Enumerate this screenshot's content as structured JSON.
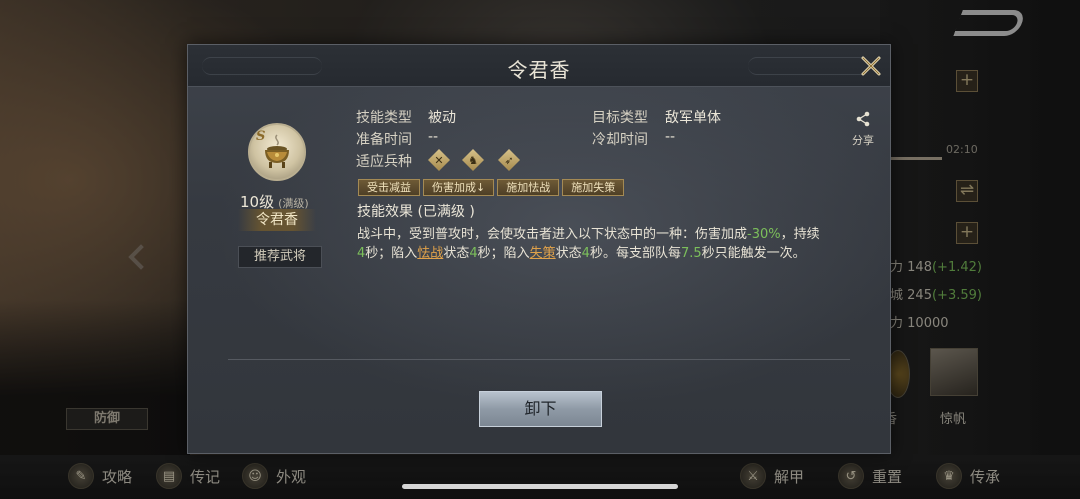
{
  "modal": {
    "title": "令君香",
    "skill": {
      "grade": "S",
      "level": "10级",
      "level_status": "(满级)",
      "name": "令君香",
      "recommend_label": "推荐武将"
    },
    "info": {
      "skill_type_label": "技能类型",
      "skill_type_value": "被动",
      "target_type_label": "目标类型",
      "target_type_value": "敌军单体",
      "prep_time_label": "准备时间",
      "prep_time_value": "--",
      "cooldown_label": "冷却时间",
      "cooldown_value": "--",
      "troops_label": "适应兵种",
      "troop_icons": [
        "spear-troop-icon",
        "cavalry-troop-icon",
        "archer-troop-icon"
      ]
    },
    "share_label": "分享",
    "tags": [
      "受击减益",
      "伤害加成↓",
      "施加怯战",
      "施加失策"
    ],
    "effect_title": "技能效果 (已满级 )",
    "effect": {
      "p1": "战斗中，受到普攻时，会使攻击者进入以下状态中的一种：伤害加成",
      "v1": "-30%",
      "p2": "，持续",
      "v2": "4",
      "p3": "秒；陷入",
      "s1": "怯战",
      "p4": "状态",
      "v3": "4",
      "p5": "秒；陷入",
      "s2": "失策",
      "p6": "状态",
      "v4": "4",
      "p7": "秒。每支部队每",
      "v5": "7.5",
      "p8": "秒只能触发一次。"
    },
    "unload_label": "卸下"
  },
  "background": {
    "timer": "02:10",
    "stats": [
      {
        "label": "力",
        "value": "148",
        "bonus": "(+1.42)"
      },
      {
        "label": "城",
        "value": "245",
        "bonus": "(+3.59)"
      },
      {
        "label": "力",
        "value": "10000",
        "bonus": ""
      }
    ],
    "hero_names": [
      "香",
      "惊帆"
    ],
    "defense_label": "防御",
    "bottom_left": [
      "攻略",
      "传记",
      "外观"
    ],
    "bottom_right": [
      "解甲",
      "重置",
      "传承"
    ]
  },
  "colors": {
    "accent_green": "#7cbf5b",
    "status_orange": "#e0a24a",
    "tag_gold": "#a48a54"
  }
}
